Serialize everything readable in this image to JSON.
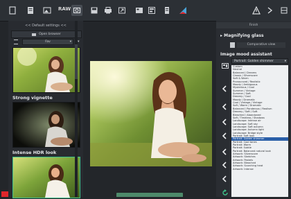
{
  "toolbar": {
    "raw_label": "RAW",
    "icons": [
      "new-document-icon",
      "open-document-icon",
      "image-icon",
      "raw-icon",
      "compare-view-icon",
      "save-icon",
      "print-icon",
      "export-icon",
      "batch-icon",
      "crop-icon",
      "layers-icon",
      "histogram-icon",
      "warning-icon",
      "filter-icon",
      "settings-icon"
    ]
  },
  "left_panel": {
    "header": "<< Default settings <<",
    "browser_button": "Open browser",
    "filter_value": "Fav",
    "presets": [
      {
        "label": ""
      },
      {
        "label": "Strong vignette"
      },
      {
        "label": "Intense HDR look"
      }
    ]
  },
  "right_panel": {
    "header": "Finish",
    "magnifier_title": "Magnifying glass",
    "comparative_label": "Comparative view",
    "mood_title": "Image mood assistant",
    "mood_selected": "Portrait: Golden shimmer",
    "mood_items": [
      "Custom",
      "Neutral",
      "Balanced / Dreams",
      "Classic / Silverscore",
      "Soft & Warm",
      "Pronounced / Realistic",
      "Moody / Ambiguous",
      "Mysterious / Cool",
      "Summer / Vintage",
      "Summer / Soft",
      "Dreamy / Cool",
      "Moody / Dramatic",
      "Cool / Vintage / Vintage",
      "Soft / Warm / Dramatic",
      "Balanced / Ponderous / Realism",
      "Dreamy / Soft / Soft",
      "Bleached / Abandoned",
      "Soft / Timeless / Shadows",
      "Landscape: Intense air",
      "Landscape: Soft sky",
      "Landscape: Soft autumn",
      "Landscape: Autumn light",
      "Landscape: Bridge style",
      "Portrait: Soft look",
      "Portrait: Golden shimmer",
      "Portrait: Cool tones",
      "Portrait: Warm",
      "Portrait: Subtle",
      "Portrait: Balanced natural look",
      "Artwork: Silverscore",
      "Artwork: Sketches",
      "Artwork: Pastels",
      "Artwork: Bleached",
      "Artwork: Scorching heat",
      "Artwork: Intense"
    ]
  },
  "colors": {
    "accent_green": "#3ec28a",
    "selection_blue": "#2a5fa8",
    "marker_red": "#e0262b"
  }
}
